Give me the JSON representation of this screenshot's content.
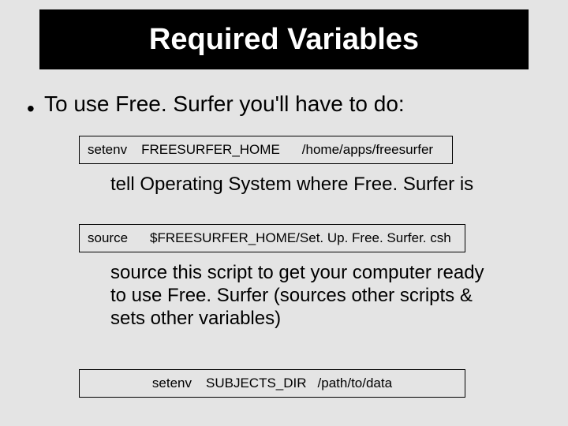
{
  "title": "Required Variables",
  "bullet": "To use Free. Surfer you'll have to do:",
  "cmd1": {
    "a": "setenv",
    "b": "FREESURFER_HOME",
    "c": "/home/apps/freesurfer"
  },
  "explain1": "tell Operating System where Free. Surfer is",
  "cmd2": {
    "a": "source",
    "b": "$FREESURFER_HOME/Set. Up. Free. Surfer. csh"
  },
  "explain2": "source this script to get your computer ready to use Free. Surfer (sources other scripts & sets other variables)",
  "cmd3": {
    "a": "setenv",
    "b": "SUBJECTS_DIR",
    "c": "/path/to/data"
  }
}
